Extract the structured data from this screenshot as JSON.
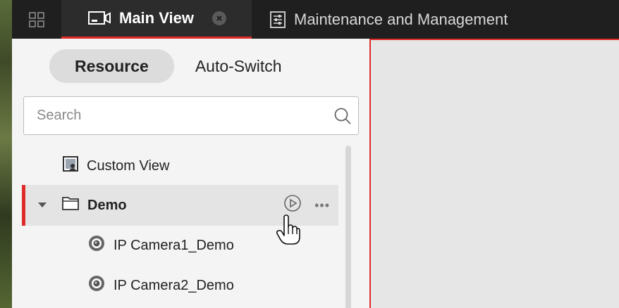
{
  "topbar": {
    "tabs": [
      {
        "label": "Main View",
        "active": true
      },
      {
        "label": "Maintenance and Management",
        "active": false
      }
    ]
  },
  "sidebar": {
    "segments": [
      {
        "label": "Resource",
        "active": true
      },
      {
        "label": "Auto-Switch",
        "active": false
      }
    ],
    "search": {
      "placeholder": "Search",
      "value": ""
    },
    "tree": [
      {
        "label": "Custom View",
        "icon": "custom-view-icon"
      },
      {
        "label": "Demo",
        "icon": "folder-icon",
        "expanded": true,
        "selected": true
      },
      {
        "label": "IP Camera1_Demo",
        "icon": "camera-icon"
      },
      {
        "label": "IP Camera2_Demo",
        "icon": "camera-icon"
      }
    ],
    "more_label": "•••"
  },
  "colors": {
    "accent": "#e02b2b",
    "topbar_bg": "#1f1f1f",
    "sidebar_bg": "#f4f4f4",
    "selected_row_bg": "#e4e4e4"
  }
}
